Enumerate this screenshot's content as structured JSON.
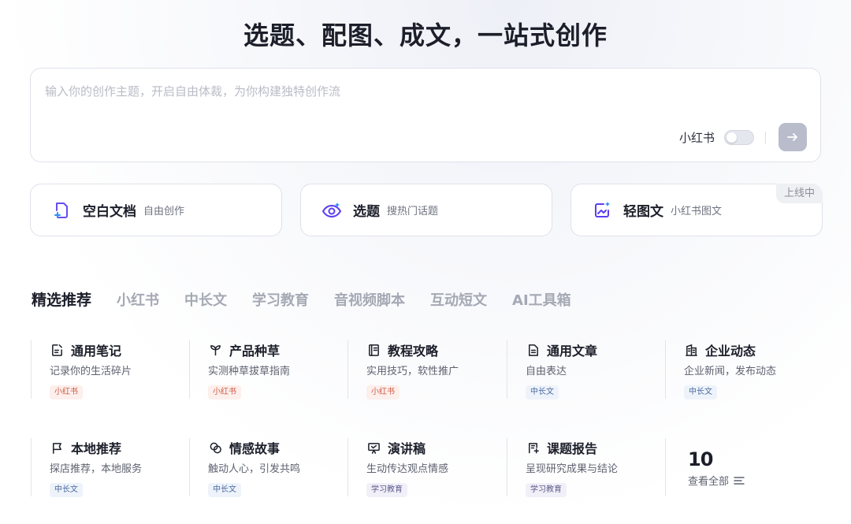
{
  "hero": {
    "title": "选题、配图、成文，一站式创作"
  },
  "composer": {
    "placeholder": "输入你的创作主题，开启自由体裁，为你构建独特创作流",
    "toggle_label": "小红书",
    "toggle_on": false
  },
  "modes": [
    {
      "title": "空白文档",
      "subtitle": "自由创作",
      "icon": "blank-doc-icon"
    },
    {
      "title": "选题",
      "subtitle": "搜热门话题",
      "icon": "eye-sparkle-icon"
    },
    {
      "title": "轻图文",
      "subtitle": "小红书图文",
      "icon": "image-sparkle-icon",
      "badge": "上线中"
    }
  ],
  "tabs": [
    "精选推荐",
    "小红书",
    "中长文",
    "学习教育",
    "音视频脚本",
    "互动短文",
    "AI工具箱"
  ],
  "templates": [
    {
      "title": "通用笔记",
      "desc": "记录你的生活碎片",
      "tag": "小红书",
      "icon": "note-edit-icon",
      "tag_color": "#cf5b45"
    },
    {
      "title": "产品种草",
      "desc": "实测种草拔草指南",
      "tag": "小红书",
      "icon": "sprout-icon",
      "tag_color": "#cf5b45"
    },
    {
      "title": "教程攻略",
      "desc": "实用技巧，软性推广",
      "tag": "小红书",
      "icon": "book-icon",
      "tag_color": "#cf5b45"
    },
    {
      "title": "通用文章",
      "desc": "自由表达",
      "tag": "中长文",
      "icon": "document-icon",
      "tag_color": "#4a6a9e"
    },
    {
      "title": "企业动态",
      "desc": "企业新闻，发布动态",
      "tag": "中长文",
      "icon": "building-icon",
      "tag_color": "#4a6a9e"
    },
    {
      "title": "本地推荐",
      "desc": "探店推荐，本地服务",
      "tag": "中长文",
      "icon": "flag-icon",
      "tag_color": "#4a6a9e"
    },
    {
      "title": "情感故事",
      "desc": "触动人心，引发共鸣",
      "tag": "中长文",
      "icon": "heart-chat-icon",
      "tag_color": "#4a6a9e"
    },
    {
      "title": "演讲稿",
      "desc": "生动传达观点情感",
      "tag": "学习教育",
      "icon": "presentation-icon",
      "tag_color": "#5e5a8e"
    },
    {
      "title": "课题报告",
      "desc": "呈现研究成果与结论",
      "tag": "学习教育",
      "icon": "report-icon",
      "tag_color": "#5e5a8e"
    }
  ],
  "more": {
    "count": "10",
    "label": "查看全部"
  }
}
